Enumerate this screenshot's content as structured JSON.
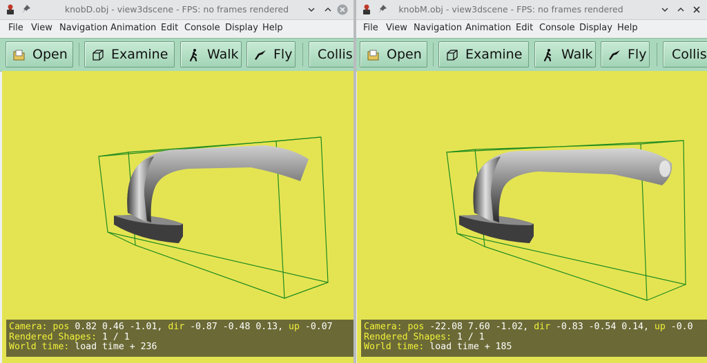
{
  "windows": [
    {
      "title": "knobD.obj - view3dscene - FPS: no frames rendered",
      "menu": [
        "File",
        "View",
        "Navigation",
        "Animation",
        "Edit",
        "Console",
        "Display",
        "Help"
      ],
      "toolbar": {
        "open": "Open",
        "examine": "Examine",
        "walk": "Walk",
        "fly": "Fly",
        "collisions": "Collis"
      },
      "status": {
        "camera_label": "Camera:",
        "pos_label": "pos",
        "pos_value": "0.82 0.46 -1.01,",
        "dir_label": "dir",
        "dir_value": "-0.87 -0.48 0.13,",
        "up_label": "up",
        "up_value": "-0.07",
        "shapes_label": "Rendered Shapes:",
        "shapes_value": "1 / 1",
        "time_label": "World time:",
        "time_value": "load time + 236"
      }
    },
    {
      "title": "knobM.obj - view3dscene - FPS: no frames rendered",
      "menu": [
        "File",
        "View",
        "Navigation",
        "Animation",
        "Edit",
        "Console",
        "Display",
        "Help"
      ],
      "toolbar": {
        "open": "Open",
        "examine": "Examine",
        "walk": "Walk",
        "fly": "Fly",
        "collisions": "Collis"
      },
      "status": {
        "camera_label": "Camera:",
        "pos_label": "pos",
        "pos_value": "-22.08 7.60 -1.02,",
        "dir_label": "dir",
        "dir_value": "-0.83 -0.54 0.14,",
        "up_label": "up",
        "up_value": "-0.0",
        "shapes_label": "Rendered Shapes:",
        "shapes_value": "1 / 1",
        "time_label": "World time:",
        "time_value": "load time + 185"
      }
    }
  ],
  "colors": {
    "viewport_bg": "#e4e452",
    "toolbar_bg": "#a9d8bd",
    "status_bg": "#6b6a36",
    "status_label": "#f2f23a",
    "bbox": "#1f8a1f"
  },
  "icons": {
    "app": "view3dscene-icon",
    "pin": "pin-icon",
    "minimize": "chevron-down-icon",
    "maximize": "chevron-up-icon",
    "close": "close-icon",
    "open": "folder-icon",
    "examine": "cube-icon",
    "walk": "walking-person-icon",
    "fly": "bird-icon"
  }
}
